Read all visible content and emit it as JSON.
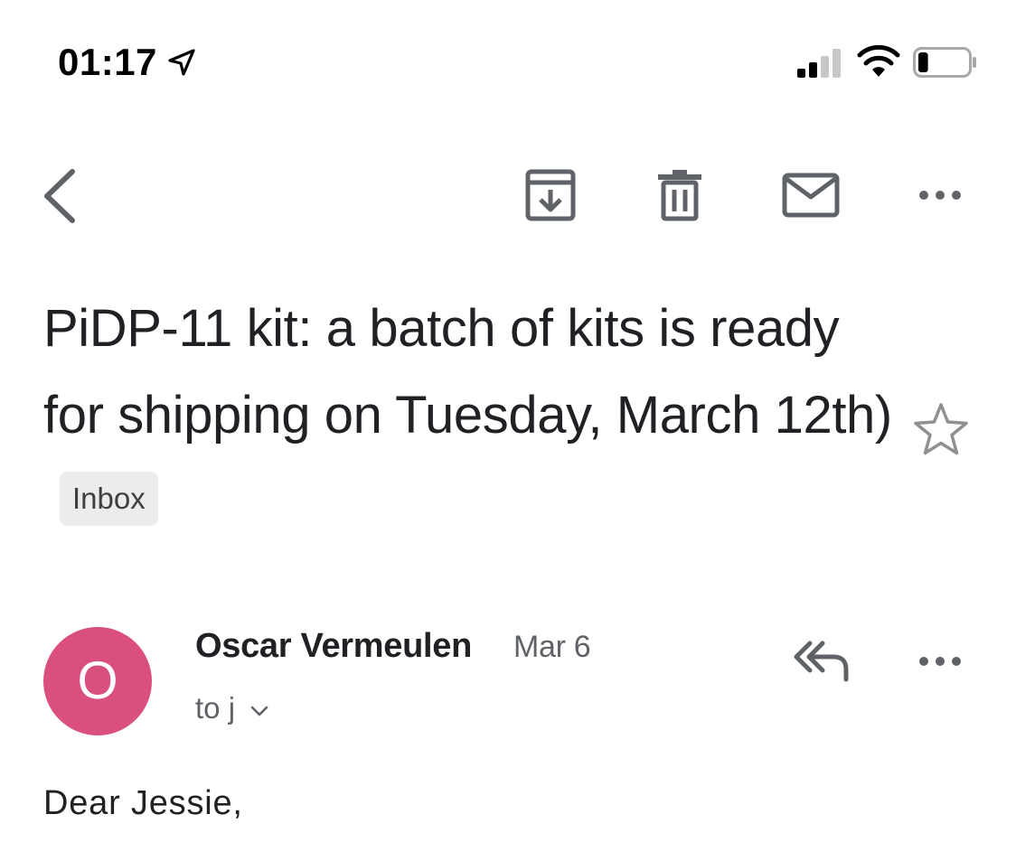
{
  "status_bar": {
    "time": "01:17",
    "location_icon": "location-arrow-icon",
    "signal_icon": "cellular-signal-icon",
    "wifi_icon": "wifi-icon",
    "battery_icon": "battery-icon",
    "battery_level": 0.2
  },
  "toolbar": {
    "back_icon": "chevron-left-icon",
    "archive_icon": "archive-icon",
    "delete_icon": "trash-icon",
    "mark_unread_icon": "envelope-icon",
    "more_icon": "more-horizontal-icon"
  },
  "email": {
    "subject": "PiDP-11 kit: a batch of kits is ready for shipping on Tuesday, March 12th)",
    "label": "Inbox",
    "star_icon": "star-outline-icon",
    "sender": {
      "initial": "O",
      "name": "Oscar Vermeulen",
      "date": "Mar 6",
      "recipient": "to j",
      "avatar_color": "#d94f7d"
    },
    "reply_all_icon": "reply-all-icon",
    "message_more_icon": "more-horizontal-icon",
    "body_first_line": "Dear Jessie,"
  }
}
